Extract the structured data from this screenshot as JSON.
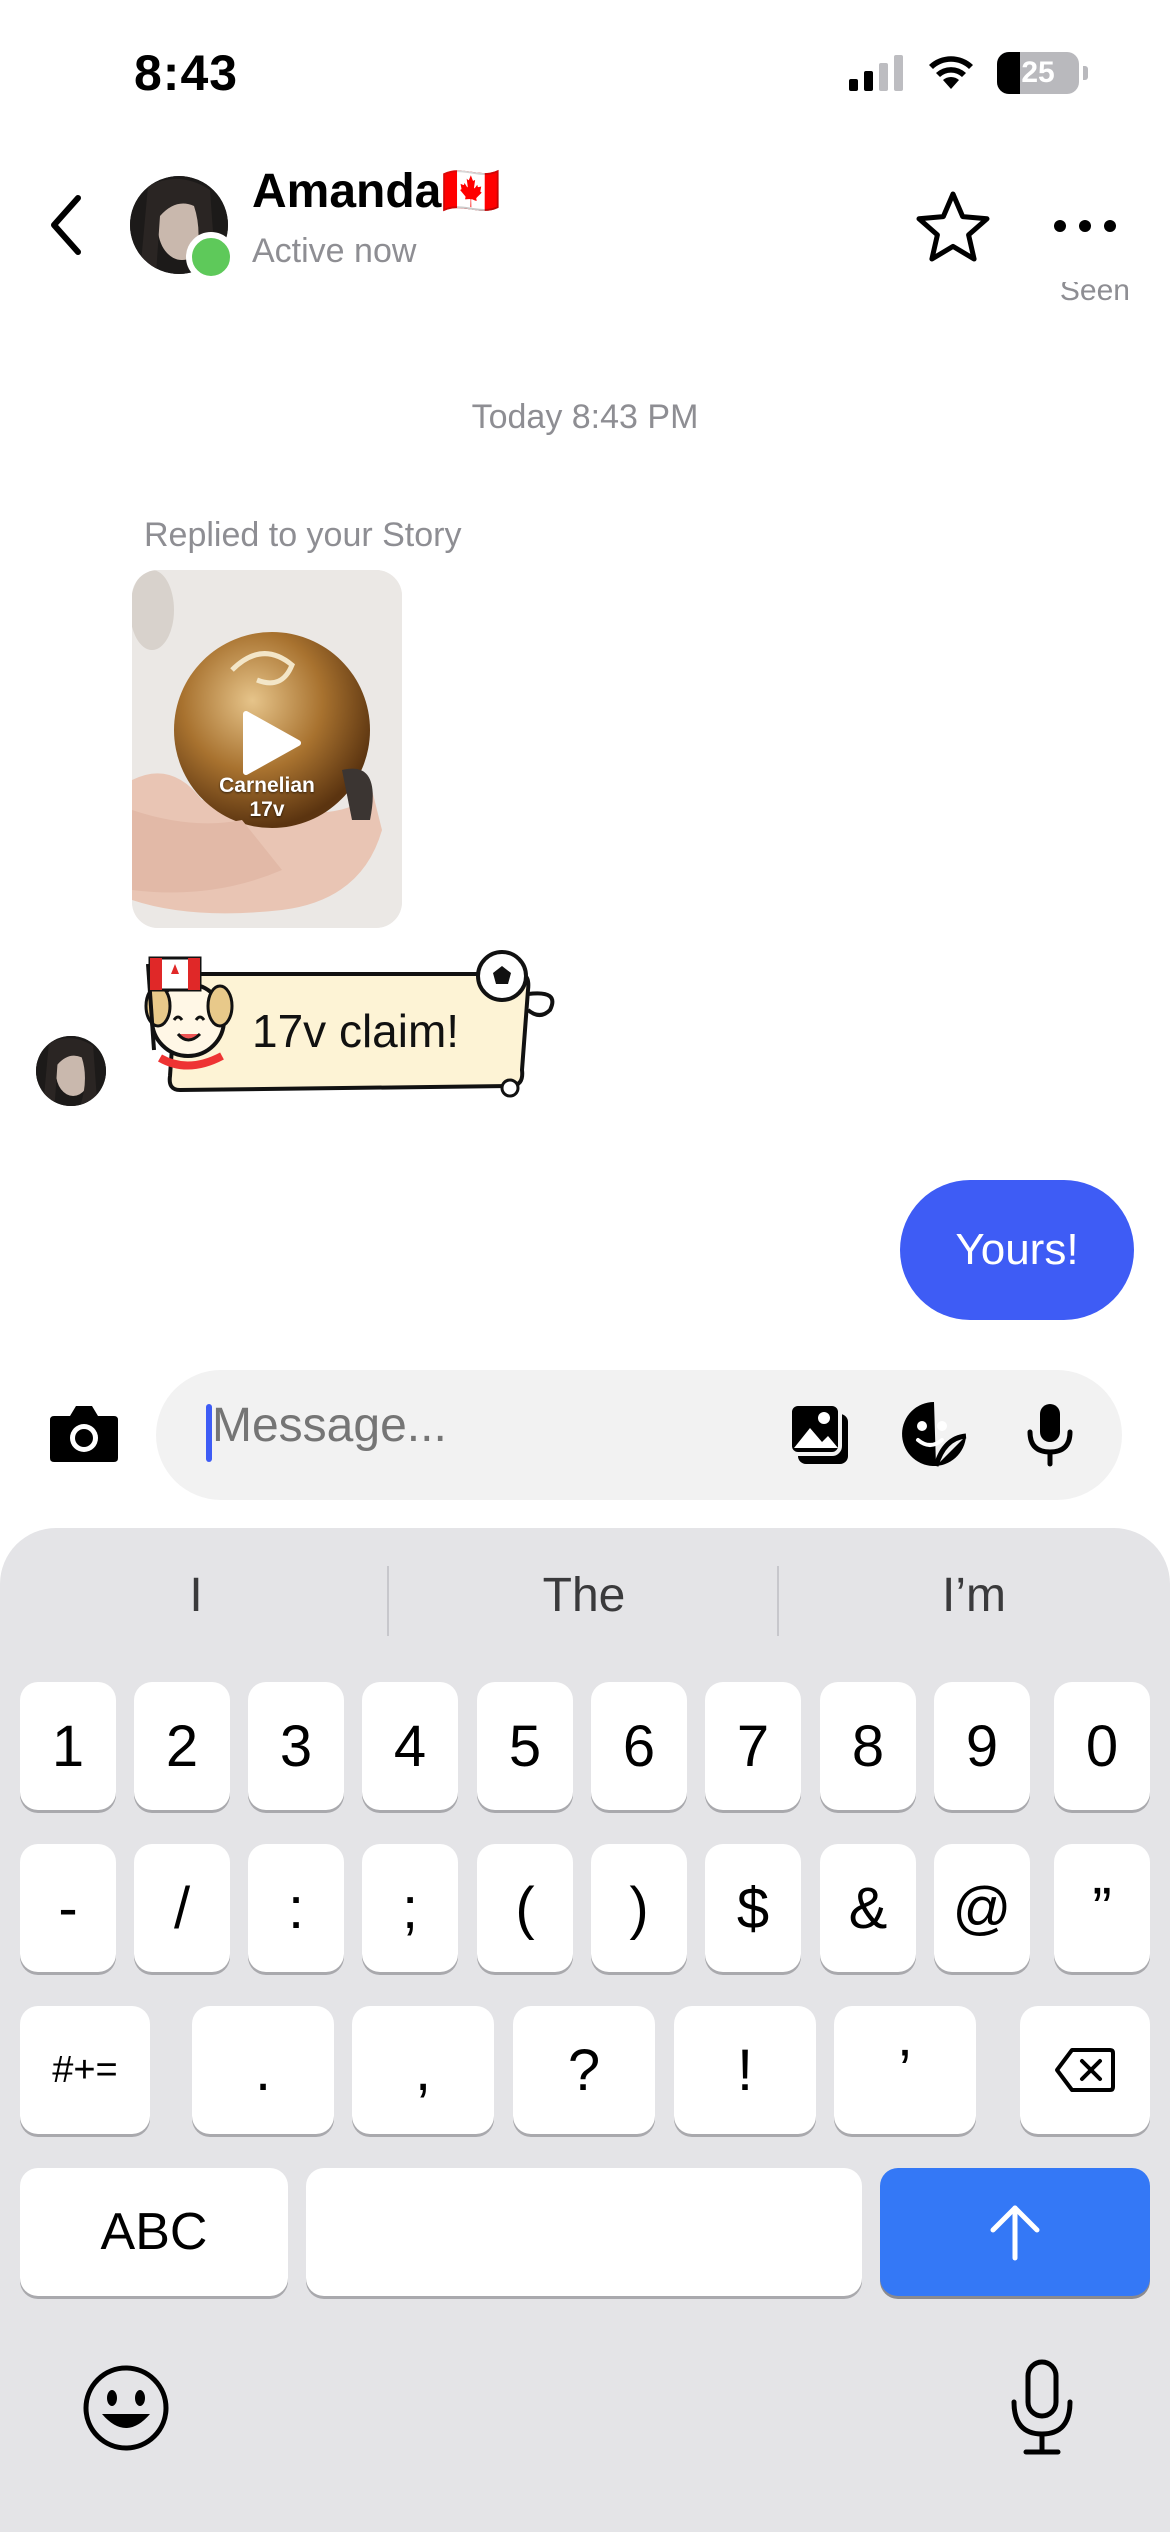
{
  "status_bar": {
    "time": "8:43",
    "battery": "25"
  },
  "header": {
    "name": "Amanda🇨🇦",
    "status": "Active now",
    "partial_seen": "Seen"
  },
  "conversation": {
    "date_stamp": "Today 8:43 PM",
    "reply_label": "Replied to your Story",
    "story_caption_line1": "Carnelian",
    "story_caption_line2": "17v",
    "incoming_message": "17v claim!",
    "outgoing_message": "Yours!"
  },
  "composer": {
    "placeholder": "Message..."
  },
  "keyboard": {
    "suggestions": [
      "I",
      "The",
      "I’m"
    ],
    "row1": [
      "1",
      "2",
      "3",
      "4",
      "5",
      "6",
      "7",
      "8",
      "9",
      "0"
    ],
    "row2": [
      "-",
      "/",
      ":",
      ";",
      "(",
      ")",
      "$",
      "&",
      "@",
      "”"
    ],
    "row3": [
      ".",
      ",",
      "?",
      "!",
      "’"
    ],
    "symbols_key": "#+=",
    "abc_key": "ABC"
  },
  "colors": {
    "accent": "#3e5cf5",
    "online": "#5ec95a",
    "enter_key": "#3478f6"
  }
}
